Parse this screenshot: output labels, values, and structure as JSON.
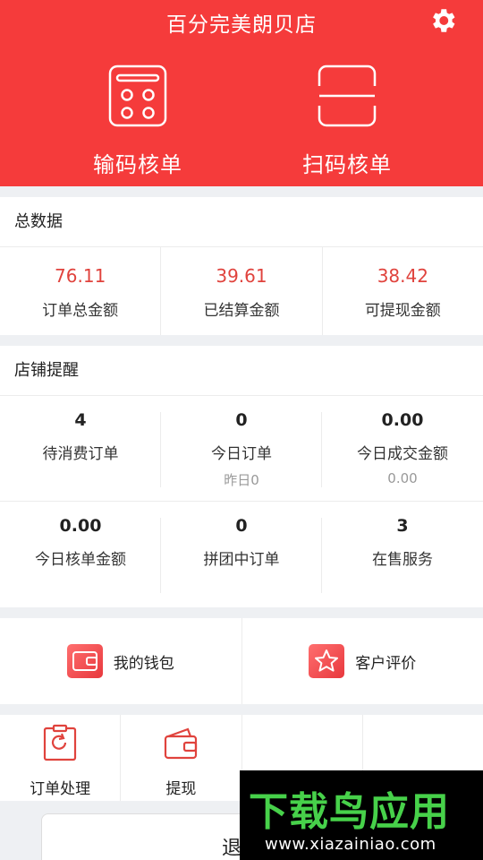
{
  "header": {
    "title": "百分完美朗贝店",
    "actions": [
      {
        "label": "输码核单",
        "icon": "keypad-icon"
      },
      {
        "label": "扫码核单",
        "icon": "scan-icon"
      }
    ],
    "settings_icon": "gear-icon"
  },
  "totals": {
    "title": "总数据",
    "items": [
      {
        "value": "76.11",
        "label": "订单总金额"
      },
      {
        "value": "39.61",
        "label": "已结算金额"
      },
      {
        "value": "38.42",
        "label": "可提现金额"
      }
    ]
  },
  "reminders": {
    "title": "店铺提醒",
    "row1": [
      {
        "value": "4",
        "label": "待消费订单",
        "sub": ""
      },
      {
        "value": "0",
        "label": "今日订单",
        "sub": "昨日0"
      },
      {
        "value": "0.00",
        "label": "今日成交金额",
        "sub": "0.00"
      }
    ],
    "row2": [
      {
        "value": "0.00",
        "label": "今日核单金额"
      },
      {
        "value": "0",
        "label": "拼团中订单"
      },
      {
        "value": "3",
        "label": "在售服务"
      }
    ]
  },
  "links": [
    {
      "label": "我的钱包",
      "icon": "wallet-icon"
    },
    {
      "label": "客户评价",
      "icon": "star-icon"
    }
  ],
  "tools": [
    {
      "label": "订单处理",
      "icon": "clipboard-refresh-icon"
    },
    {
      "label": "提现",
      "icon": "withdraw-wallet-icon"
    },
    {
      "label": "",
      "icon": ""
    },
    {
      "label": "",
      "icon": ""
    }
  ],
  "logout_label": "退出",
  "watermark": {
    "text": "下载鸟应用",
    "url": "www.xiazainiao.com"
  },
  "colors": {
    "brand": "#f53b3b",
    "value_red": "#e0433d",
    "background": "#eef0f3"
  }
}
